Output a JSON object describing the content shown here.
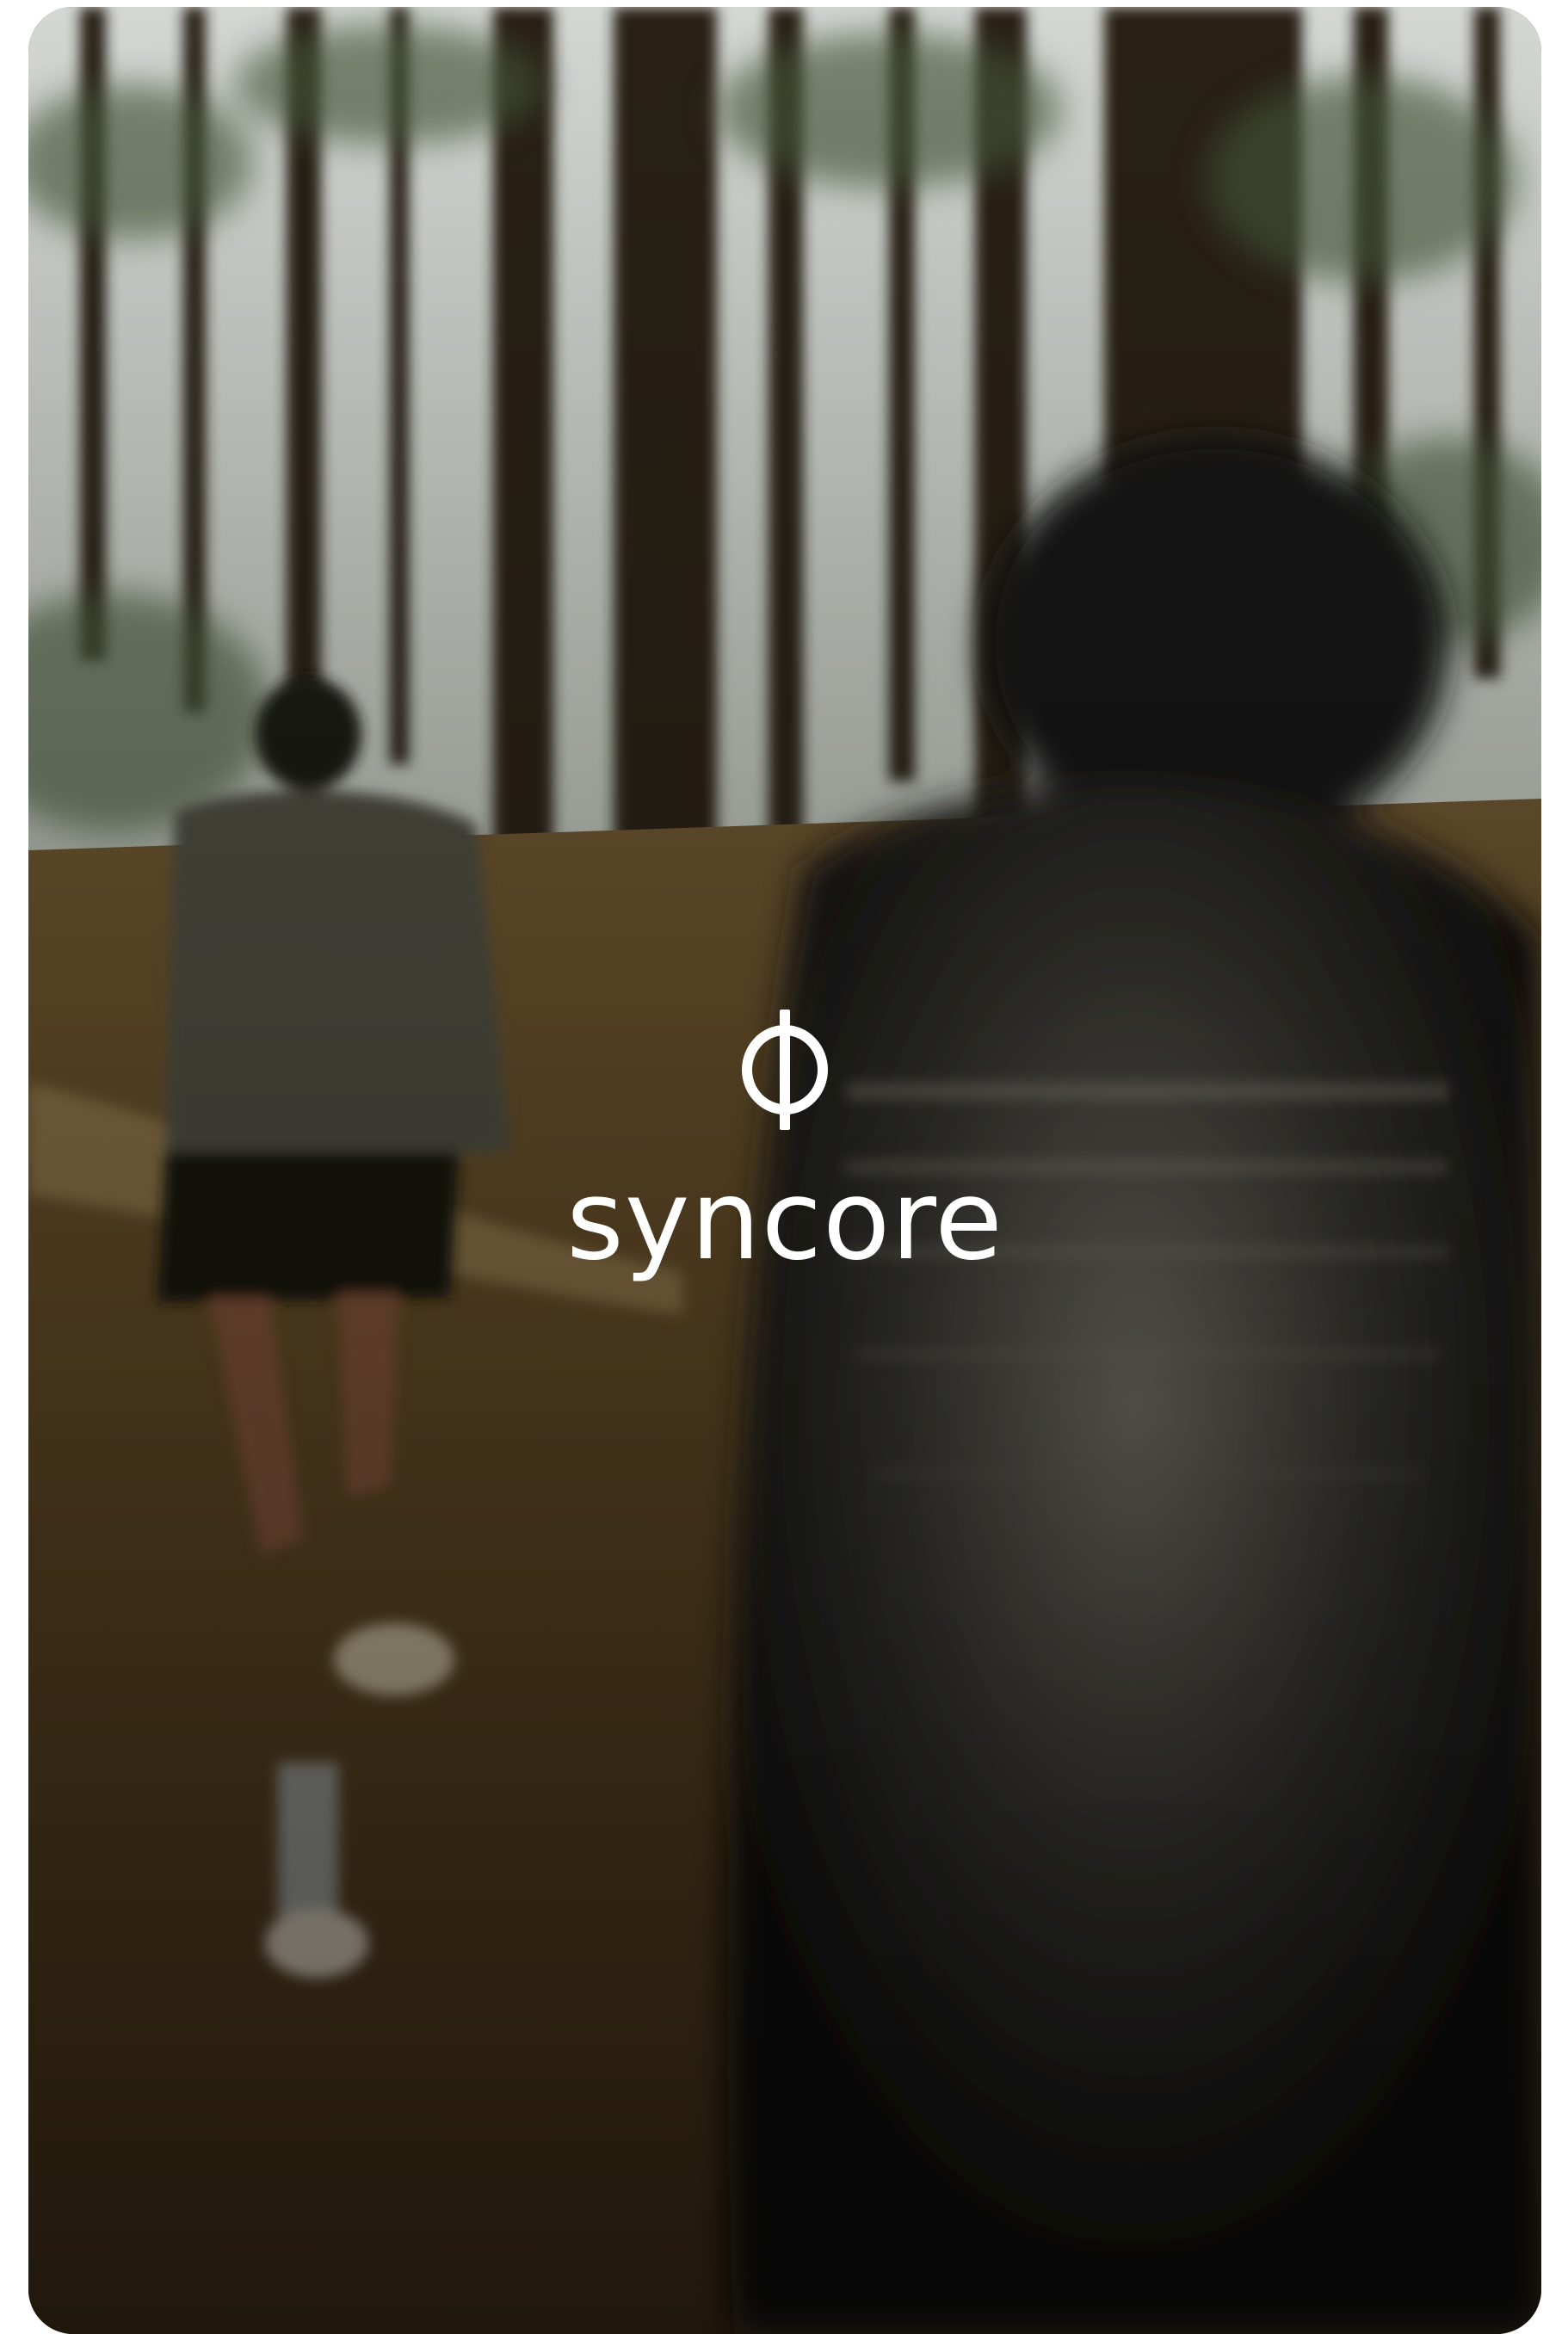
{
  "brand": {
    "name": "syncore",
    "logo_icon": "phi-logo-icon"
  },
  "background": {
    "subject": "trail-runners-in-forest-photo"
  },
  "colors": {
    "text": "#ffffff"
  }
}
